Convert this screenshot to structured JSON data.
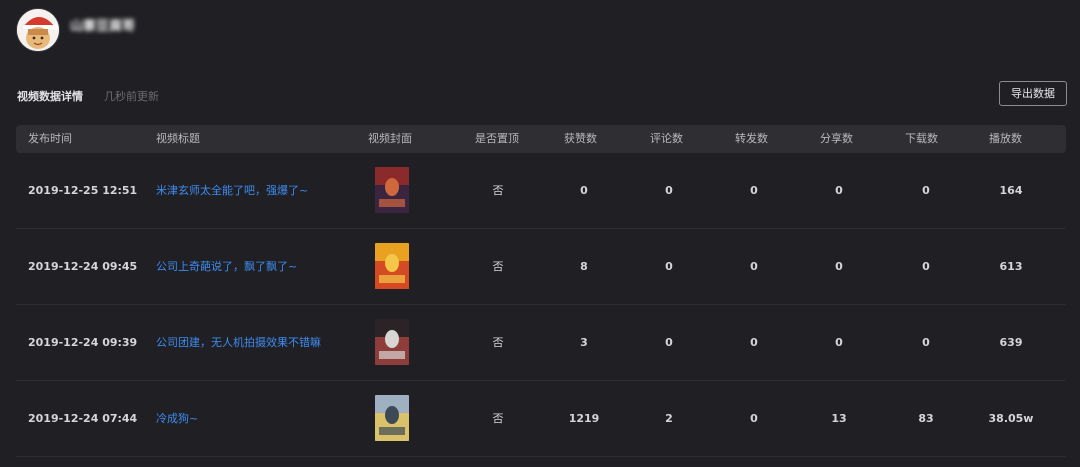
{
  "profile": {
    "username": "山寨豆腐哥"
  },
  "section": {
    "title": "视频数据详情",
    "update_note": "几秒前更新",
    "export_label": "导出数据"
  },
  "table": {
    "headers": {
      "time": "发布时间",
      "title": "视频标题",
      "cover": "视频封面",
      "pinned": "是否置顶",
      "likes": "获赞数",
      "comments": "评论数",
      "reposts": "转发数",
      "shares": "分享数",
      "downloads": "下载数",
      "plays": "播放数"
    },
    "rows": [
      {
        "time": "2019-12-25 12:51",
        "title": "米津玄师太全能了吧，强爆了~",
        "pinned": "否",
        "likes": "0",
        "comments": "0",
        "reposts": "0",
        "shares": "0",
        "downloads": "0",
        "plays": "164",
        "thumb_colors": [
          "#8a2a2a",
          "#3a2440",
          "#d0683e"
        ]
      },
      {
        "time": "2019-12-24 09:45",
        "title": "公司上奇葩说了，飘了飘了~",
        "pinned": "否",
        "likes": "8",
        "comments": "0",
        "reposts": "0",
        "shares": "0",
        "downloads": "0",
        "plays": "613",
        "thumb_colors": [
          "#e8a21f",
          "#d44a22",
          "#f5c64a"
        ]
      },
      {
        "time": "2019-12-24 09:39",
        "title": "公司团建，无人机拍摄效果不错嘛",
        "pinned": "否",
        "likes": "3",
        "comments": "0",
        "reposts": "0",
        "shares": "0",
        "downloads": "0",
        "plays": "639",
        "thumb_colors": [
          "#2b2326",
          "#8d3d3a",
          "#d8d6d2"
        ]
      },
      {
        "time": "2019-12-24 07:44",
        "title": "冷成狗~",
        "pinned": "否",
        "likes": "1219",
        "comments": "2",
        "reposts": "0",
        "shares": "13",
        "downloads": "83",
        "plays": "38.05w",
        "thumb_colors": [
          "#9fb0c2",
          "#d9c26a",
          "#3d4a55"
        ]
      }
    ]
  },
  "colors": {
    "background": "#202024",
    "link": "#3d8bf0",
    "header_bg": "#2e2e33"
  }
}
